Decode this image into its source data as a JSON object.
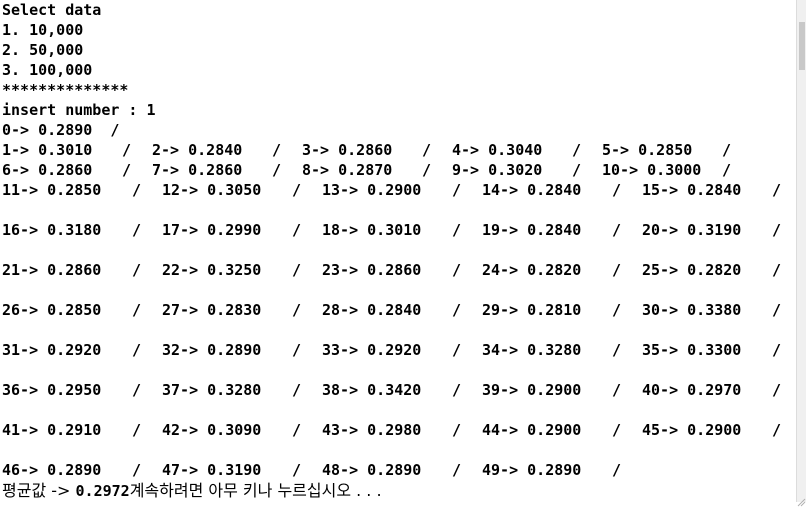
{
  "console": {
    "header_lines": [
      "Select data",
      "1. 10,000",
      "2. 50,000",
      "3. 100,000",
      "**************",
      "insert number : 1"
    ],
    "row0": "0-> 0.2890  /",
    "rows": [
      [
        "1-> 0.3010",
        "2-> 0.2840",
        "3-> 0.2860",
        "4-> 0.3040",
        "5-> 0.2850"
      ],
      [
        "6-> 0.2860",
        "7-> 0.2860",
        "8-> 0.2870",
        "9-> 0.3020",
        "10-> 0.3000"
      ],
      [
        "11-> 0.2850",
        "12-> 0.3050",
        "13-> 0.2900",
        "14-> 0.2840",
        "15-> 0.2840"
      ],
      [
        "16-> 0.3180",
        "17-> 0.2990",
        "18-> 0.3010",
        "19-> 0.2840",
        "20-> 0.3190"
      ],
      [
        "21-> 0.2860",
        "22-> 0.3250",
        "23-> 0.2860",
        "24-> 0.2820",
        "25-> 0.2820"
      ],
      [
        "26-> 0.2850",
        "27-> 0.2830",
        "28-> 0.2840",
        "29-> 0.2810",
        "30-> 0.3380"
      ],
      [
        "31-> 0.2920",
        "32-> 0.2890",
        "33-> 0.2920",
        "34-> 0.3280",
        "35-> 0.3300"
      ],
      [
        "36-> 0.2950",
        "37-> 0.3280",
        "38-> 0.3420",
        "39-> 0.2900",
        "40-> 0.2970"
      ],
      [
        "41-> 0.2910",
        "42-> 0.3090",
        "43-> 0.2980",
        "44-> 0.2900",
        "45-> 0.2900"
      ],
      [
        "46-> 0.2890",
        "47-> 0.3190",
        "48-> 0.2890",
        "49-> 0.2890"
      ]
    ],
    "separator": "/",
    "footer": {
      "prefix": "평균값 -> ",
      "average": "0.2972",
      "suffix": "계속하려면 아무 키나 누르십시오 . . ."
    }
  }
}
